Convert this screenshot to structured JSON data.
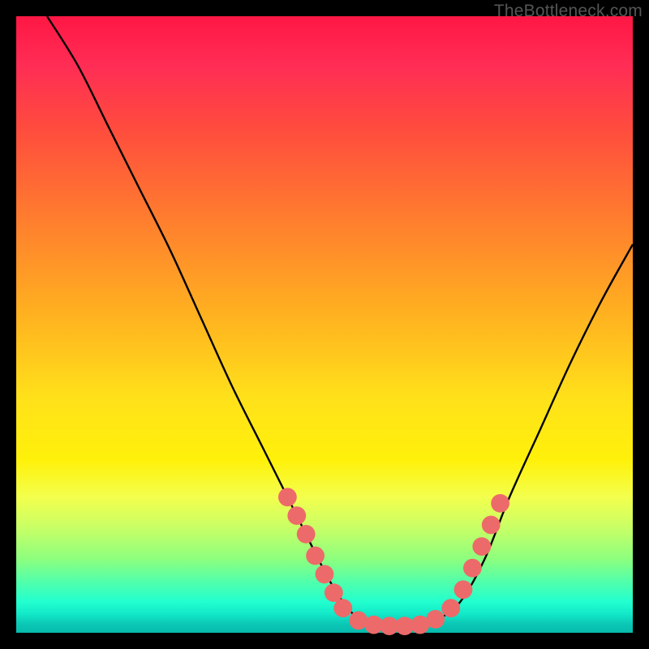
{
  "watermark": "TheBottleneck.com",
  "chart_data": {
    "type": "line",
    "title": "",
    "xlabel": "",
    "ylabel": "",
    "xlim": [
      0,
      100
    ],
    "ylim": [
      0,
      100
    ],
    "grid": false,
    "legend": false,
    "series": [
      {
        "name": "bottleneck-curve",
        "color": "#000000",
        "x": [
          5,
          10,
          15,
          20,
          25,
          30,
          35,
          40,
          45,
          50,
          53,
          56,
          60,
          64,
          68,
          72,
          76,
          80,
          85,
          90,
          95,
          100
        ],
        "y": [
          100,
          92,
          82,
          72,
          62,
          51,
          40,
          30,
          20,
          10,
          5,
          2,
          1,
          1,
          2,
          5,
          12,
          22,
          33,
          44,
          54,
          63
        ]
      }
    ],
    "markers": {
      "name": "highlight-dots",
      "color": "#ed6a6a",
      "radius_pct": 1.5,
      "points": [
        {
          "x": 44.0,
          "y": 22.0
        },
        {
          "x": 45.5,
          "y": 19.0
        },
        {
          "x": 47.0,
          "y": 16.0
        },
        {
          "x": 48.5,
          "y": 12.5
        },
        {
          "x": 50.0,
          "y": 9.5
        },
        {
          "x": 51.5,
          "y": 6.5
        },
        {
          "x": 53.0,
          "y": 4.0
        },
        {
          "x": 55.5,
          "y": 2.0
        },
        {
          "x": 58.0,
          "y": 1.3
        },
        {
          "x": 60.5,
          "y": 1.1
        },
        {
          "x": 63.0,
          "y": 1.1
        },
        {
          "x": 65.5,
          "y": 1.3
        },
        {
          "x": 68.0,
          "y": 2.2
        },
        {
          "x": 70.5,
          "y": 4.0
        },
        {
          "x": 72.5,
          "y": 7.0
        },
        {
          "x": 74.0,
          "y": 10.5
        },
        {
          "x": 75.5,
          "y": 14.0
        },
        {
          "x": 77.0,
          "y": 17.5
        },
        {
          "x": 78.5,
          "y": 21.0
        }
      ]
    }
  }
}
